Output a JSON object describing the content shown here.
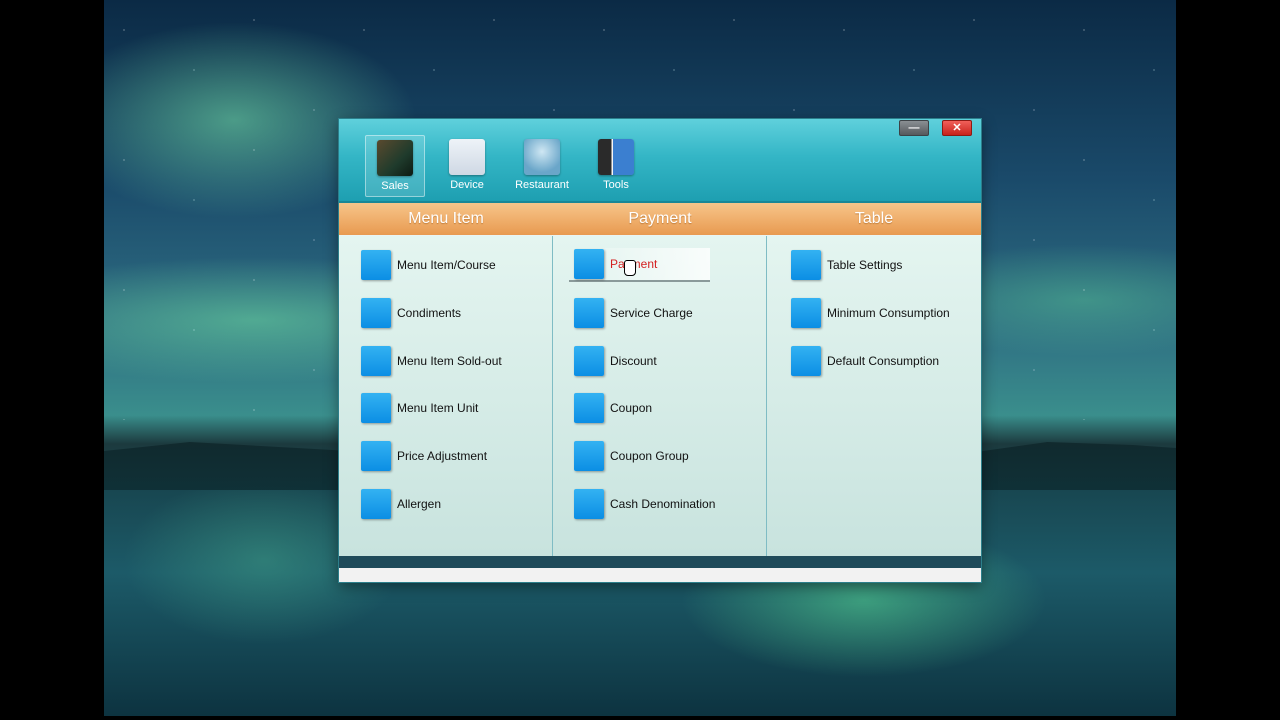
{
  "toolbar": {
    "items": [
      {
        "label": "Sales",
        "icon": "sales-book-icon"
      },
      {
        "label": "Device",
        "icon": "device-chart-icon"
      },
      {
        "label": "Restaurant",
        "icon": "restaurant-table-icon"
      },
      {
        "label": "Tools",
        "icon": "tools-devices-icon"
      }
    ]
  },
  "window_controls": {
    "minimize": "—",
    "close": "✕"
  },
  "columns": [
    {
      "title": "Menu Item",
      "items": [
        "Menu Item/Course",
        "Condiments",
        "Menu Item Sold-out",
        "Menu Item Unit",
        "Price Adjustment",
        "Allergen"
      ]
    },
    {
      "title": "Payment",
      "items": [
        "Payment",
        "Service Charge",
        "Discount",
        "Coupon",
        "Coupon Group",
        "Cash Denomination"
      ]
    },
    {
      "title": "Table",
      "items": [
        "Table Settings",
        "Minimum Consumption",
        "Default Consumption"
      ]
    }
  ],
  "colors": {
    "titlebar": "#34b6c6",
    "header_band": "#e89a50",
    "item_icon": "#1aa3ec",
    "active_text": "#d42020"
  }
}
